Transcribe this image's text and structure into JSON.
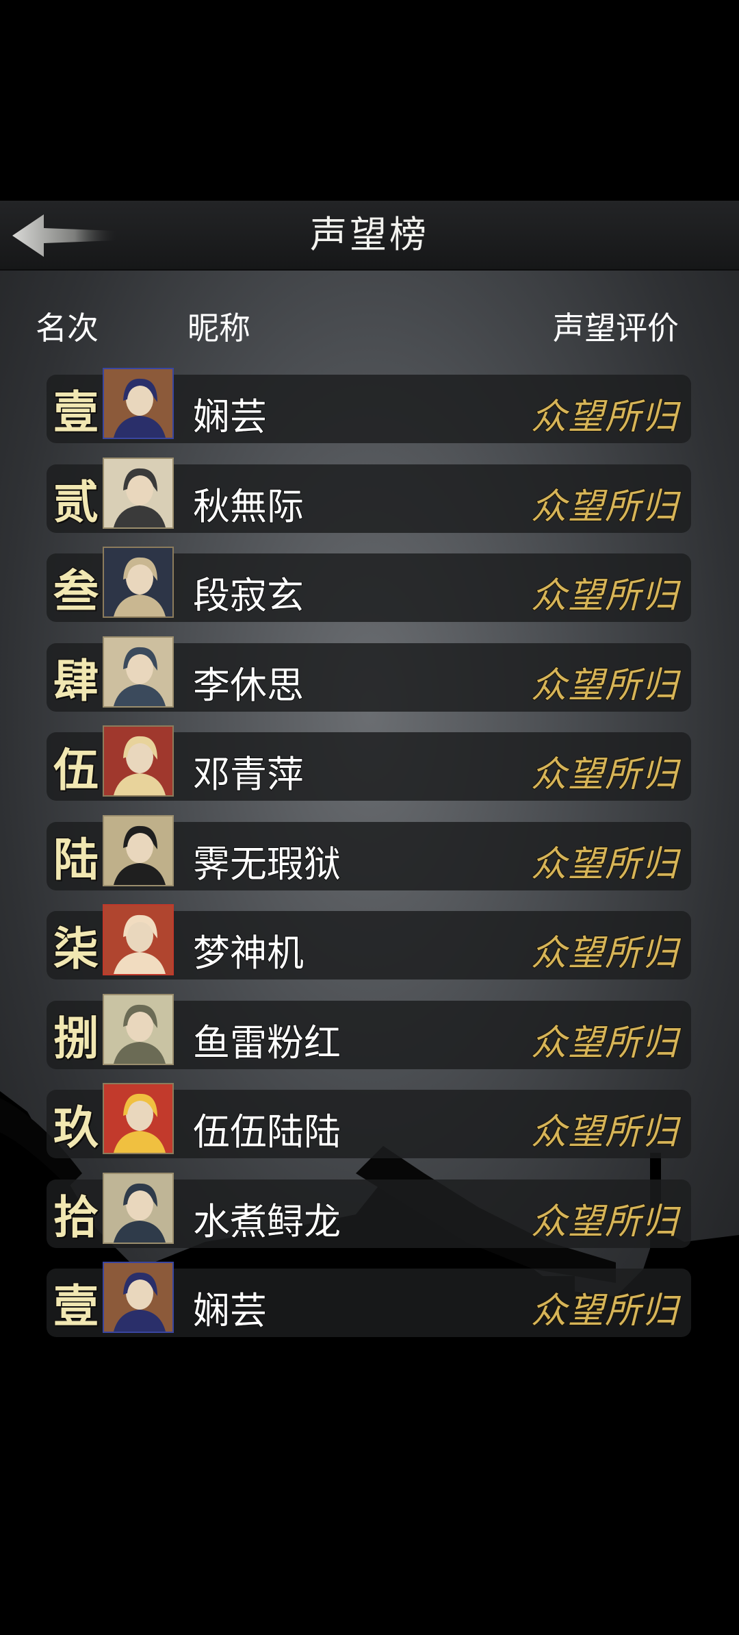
{
  "header": {
    "title": "声望榜"
  },
  "columns": {
    "rank": "名次",
    "name": "昵称",
    "reputation": "声望评价"
  },
  "rows": [
    {
      "rank": "壹",
      "name": "娴芸",
      "rep": "众望所归",
      "avatar": {
        "bg": "#8c5a3a",
        "accent": "#2a2f6a",
        "frame": "#3a46a0"
      }
    },
    {
      "rank": "贰",
      "name": "秋無际",
      "rep": "众望所归",
      "avatar": {
        "bg": "#d9cfb6",
        "accent": "#3a3a3a",
        "frame": "#9b8e6e"
      }
    },
    {
      "rank": "叁",
      "name": "段寂玄",
      "rep": "众望所归",
      "avatar": {
        "bg": "#2d3547",
        "accent": "#c9b791",
        "frame": "#8c7c5c"
      }
    },
    {
      "rank": "肆",
      "name": "李休思",
      "rep": "众望所归",
      "avatar": {
        "bg": "#cdbf9f",
        "accent": "#3b4a5c",
        "frame": "#9b8e6e"
      }
    },
    {
      "rank": "伍",
      "name": "邓青萍",
      "rep": "众望所归",
      "avatar": {
        "bg": "#a0382d",
        "accent": "#e8d39b",
        "frame": "#8c7c5c"
      }
    },
    {
      "rank": "陆",
      "name": "霁无瑕狱",
      "rep": "众望所归",
      "avatar": {
        "bg": "#bfb08a",
        "accent": "#1f1f1f",
        "frame": "#9b8e6e"
      }
    },
    {
      "rank": "柒",
      "name": "梦神机",
      "rep": "众望所归",
      "avatar": {
        "bg": "#b0452f",
        "accent": "#f1dcc0",
        "frame": "#c0392b"
      }
    },
    {
      "rank": "捌",
      "name": "鱼雷粉红",
      "rep": "众望所归",
      "avatar": {
        "bg": "#c9c3a3",
        "accent": "#6b6b55",
        "frame": "#9b8e6e"
      }
    },
    {
      "rank": "玖",
      "name": "伍伍陆陆",
      "rep": "众望所归",
      "avatar": {
        "bg": "#c23a2c",
        "accent": "#f0c040",
        "frame": "#8c7c5c"
      }
    },
    {
      "rank": "拾",
      "name": "水煮鲟龙",
      "rep": "众望所归",
      "avatar": {
        "bg": "#bfb596",
        "accent": "#2f3b4a",
        "frame": "#9b8e6e"
      }
    },
    {
      "rank": "壹",
      "name": "娴芸",
      "rep": "众望所归",
      "avatar": {
        "bg": "#8c5a3a",
        "accent": "#2a2f6a",
        "frame": "#3a46a0"
      }
    }
  ]
}
